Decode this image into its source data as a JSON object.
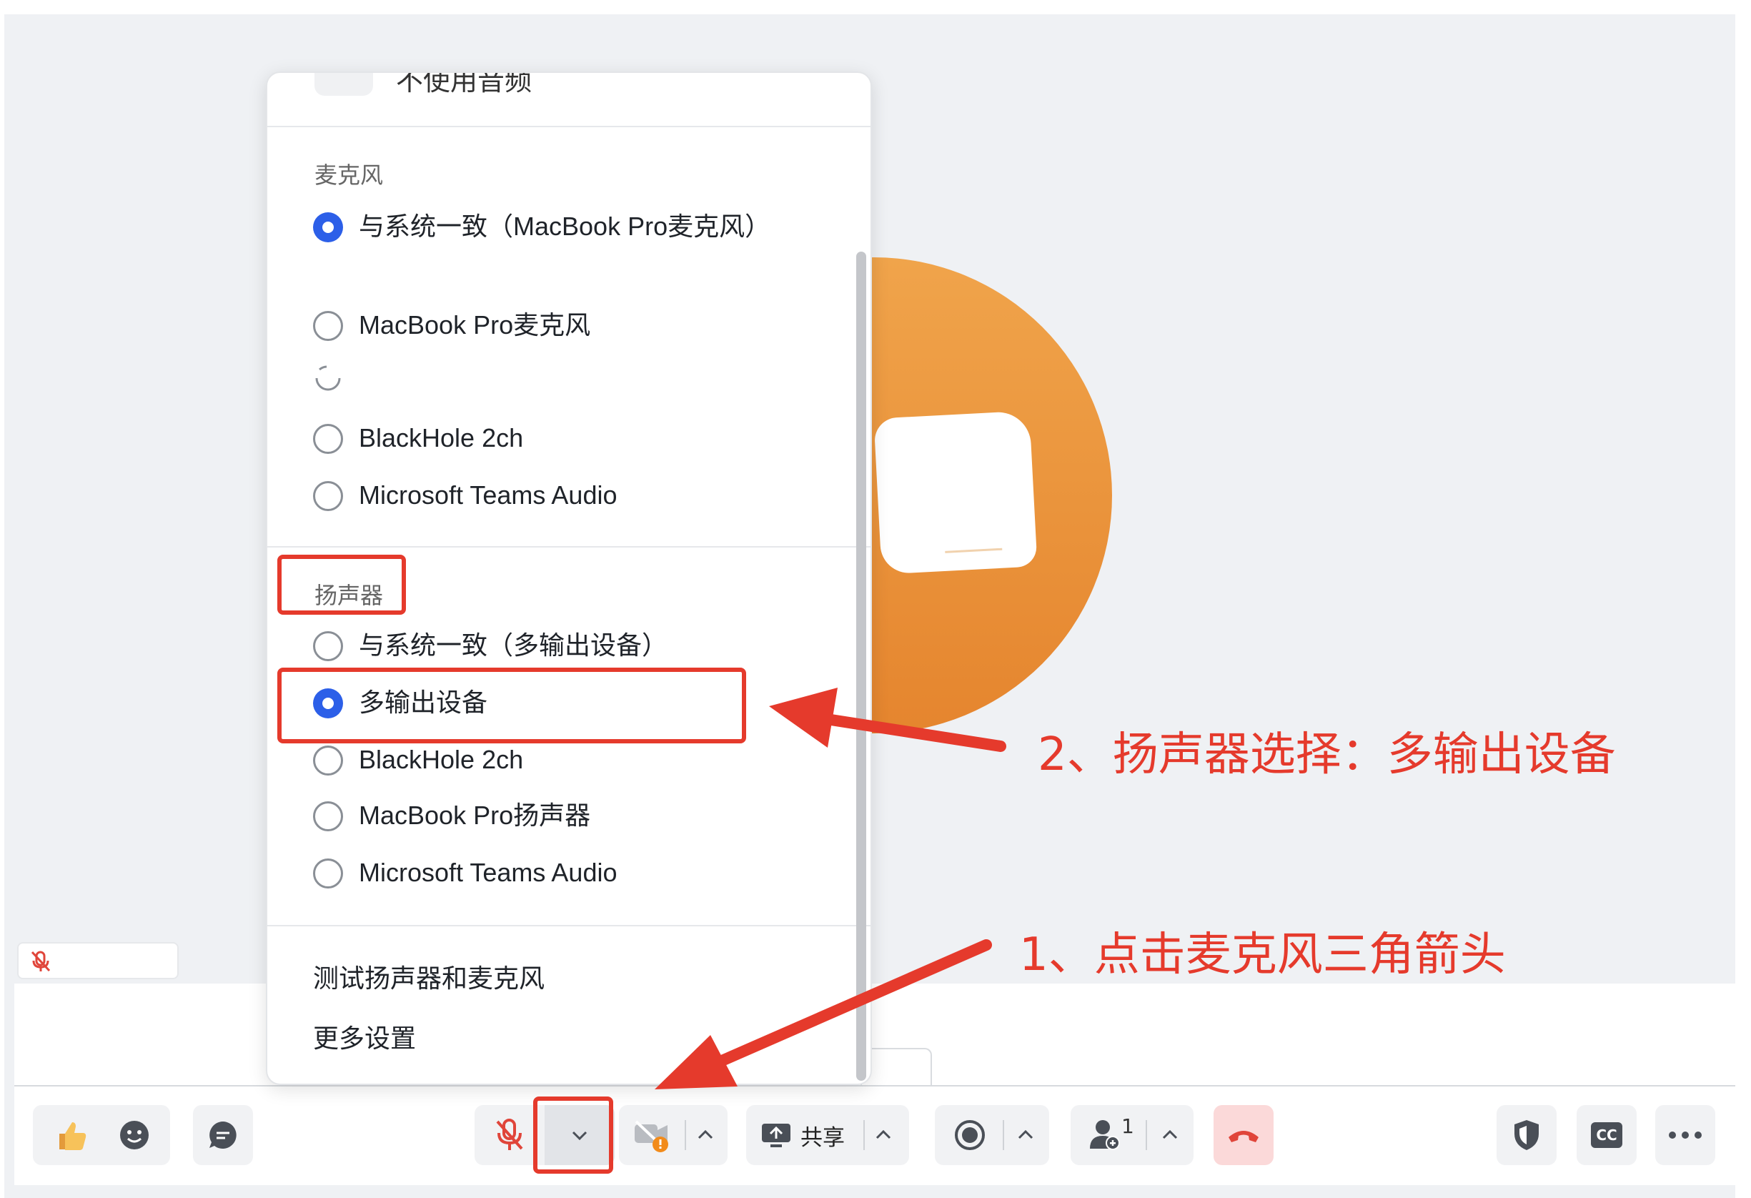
{
  "colors": {
    "accent": "#2c5fe8",
    "annotation": "#e53a2c",
    "avatar": "#ef9a40",
    "end_call_bg": "#fbd9d9"
  },
  "menu": {
    "top_item_label": "不使用音频",
    "microphone": {
      "title": "麦克风",
      "options": [
        {
          "label": "与系统一致（MacBook Pro麦克风）",
          "checked": true
        },
        {
          "label": "MacBook Pro麦克风",
          "checked": false
        },
        {
          "label": "BlackHole 2ch",
          "checked": false
        },
        {
          "label": "Microsoft Teams Audio",
          "checked": false
        }
      ]
    },
    "speaker": {
      "title": "扬声器",
      "options": [
        {
          "label": "与系统一致（多输出设备）",
          "checked": false
        },
        {
          "label": "多输出设备",
          "checked": true
        },
        {
          "label": "BlackHole 2ch",
          "checked": false
        },
        {
          "label": "MacBook Pro扬声器",
          "checked": false
        },
        {
          "label": "Microsoft Teams Audio",
          "checked": false
        }
      ]
    },
    "actions": {
      "test": "测试扬声器和麦克风",
      "more": "更多设置"
    }
  },
  "toolbar": {
    "share_label": "共享",
    "participant_count": "1",
    "icons": [
      "thumbs-up-icon",
      "emoji-icon",
      "chat-icon",
      "mic-off-icon",
      "chevron-down-icon",
      "video-off-icon",
      "share-screen-icon",
      "record-icon",
      "participants-icon",
      "end-call-icon",
      "security-icon",
      "captions-icon",
      "more-icon"
    ],
    "captions_label": "CC"
  },
  "annotations": {
    "step1": "1、点击麦克风三角箭头",
    "step2": "2、扬声器选择：多输出设备"
  }
}
